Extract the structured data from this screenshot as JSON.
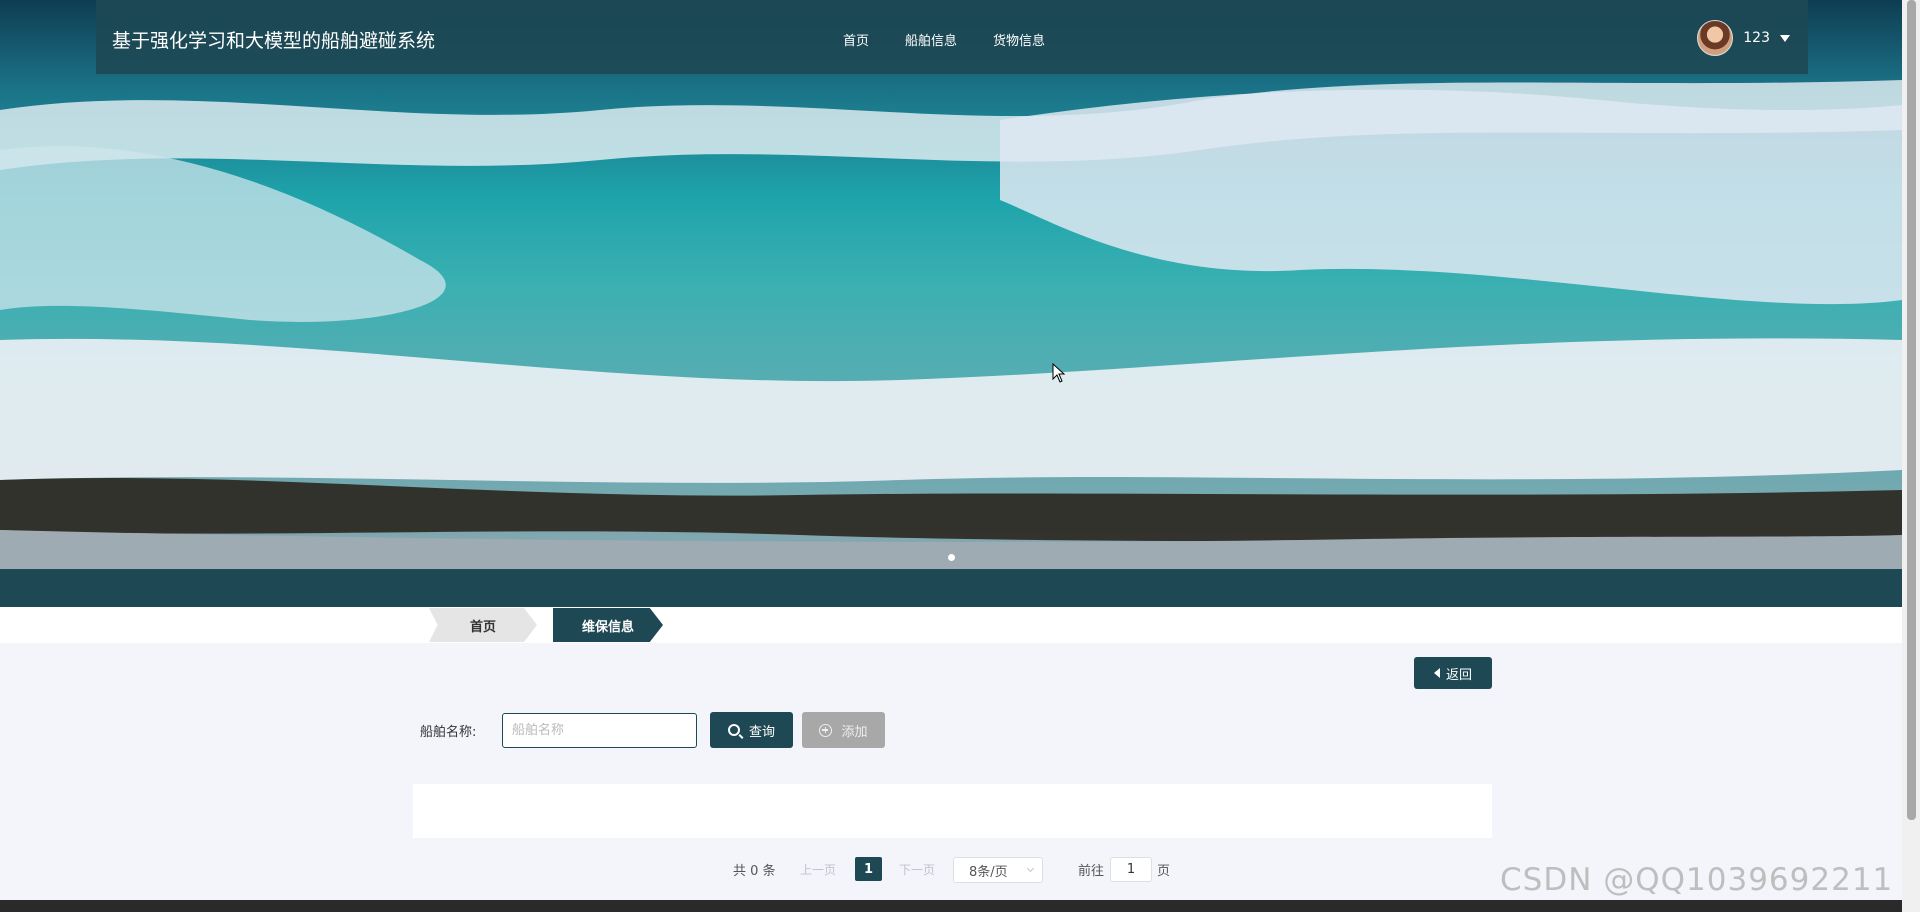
{
  "header": {
    "site_title": "基于强化学习和大模型的船舶避碰系统",
    "nav": [
      "首页",
      "船舶信息",
      "货物信息"
    ],
    "username": "123"
  },
  "breadcrumb": {
    "home": "首页",
    "current": "维保信息"
  },
  "toolbar": {
    "back_label": "返回"
  },
  "search": {
    "label": "船舶名称:",
    "placeholder": "船舶名称",
    "query_label": "查询",
    "add_label": "添加"
  },
  "pagination": {
    "total_text": "共 0 条",
    "prev_label": "上一页",
    "current_page": "1",
    "next_label": "下一页",
    "page_size": "8条/页",
    "goto_label": "前往",
    "goto_value": "1",
    "page_unit": "页"
  },
  "watermark": "CSDN @QQ1039692211",
  "colors": {
    "primary": "#1e4854",
    "disabled_button": "#a8a8a8",
    "page_bg": "#f4f5fb"
  },
  "icons": [
    "search-icon",
    "plus-circle-icon",
    "caret-left-icon",
    "caret-down-icon"
  ]
}
